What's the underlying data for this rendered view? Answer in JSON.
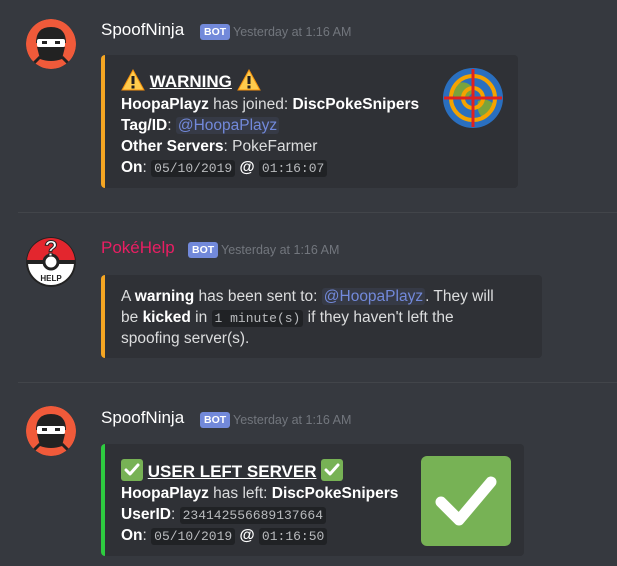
{
  "messages": [
    {
      "author": "SpoofNinja",
      "author_color": "#ffffff",
      "bot_tag": "BOT",
      "timestamp": "Yesterday at 1:16 AM",
      "embed": {
        "accent": "#f5a623",
        "title": "WARNING",
        "user": "HoopaPlayz",
        "joined_text": "has joined:",
        "server": "DiscPokeSnipers",
        "tag_label": "Tag/ID",
        "tag_value": "@HoopaPlayz",
        "other_label": "Other Servers",
        "other_value": "PokeFarmer",
        "on_label": "On",
        "on_date": "05/10/2019",
        "at": "@",
        "on_time": "01:16:07"
      }
    },
    {
      "author": "PokéHelp",
      "author_color": "#e91e63",
      "bot_tag": "BOT",
      "timestamp": "Yesterday at 1:16 AM",
      "embed": {
        "accent": "#f5a623",
        "t1": "A",
        "t2": "warning",
        "t3": "has been sent to:",
        "mention": "@HoopaPlayz",
        "t4": ". They will",
        "t5": "be",
        "t6": "kicked",
        "t7": "in",
        "code": "1 minute(s)",
        "t8": "if they haven't left the",
        "t9": "spoofing server(s)."
      }
    },
    {
      "author": "SpoofNinja",
      "author_color": "#ffffff",
      "bot_tag": "BOT",
      "timestamp": "Yesterday at 1:16 AM",
      "embed": {
        "accent": "#2ecc40",
        "title": "USER LEFT SERVER",
        "user": "HoopaPlayz",
        "left_text": "has left:",
        "server": "DiscPokeSnipers",
        "userid_label": "UserID",
        "userid_value": "234142556689137664",
        "on_label": "On",
        "on_date": "05/10/2019",
        "at": "@",
        "on_time": "01:16:50"
      }
    }
  ]
}
